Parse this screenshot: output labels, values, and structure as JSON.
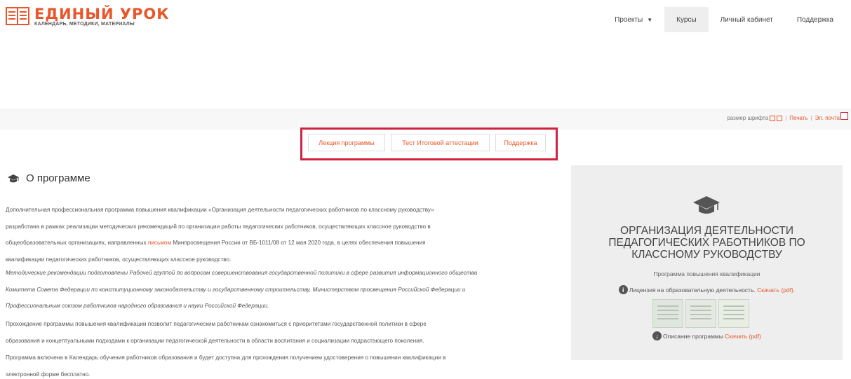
{
  "header": {
    "logo_title": "ЕДИНЫЙ УРОК",
    "logo_subtitle": "КАЛЕНДАРЬ, МЕТОДИКИ, МАТЕРИАЛЫ",
    "nav": [
      {
        "label": "Проекты",
        "has_dropdown": true,
        "active": false
      },
      {
        "label": "Курсы",
        "active": true
      },
      {
        "label": "Личный кабинет",
        "active": false
      },
      {
        "label": "Поддержка",
        "active": false
      }
    ]
  },
  "toolbar": {
    "font_size_label": "размер шрифта",
    "print_label": "Печать",
    "email_label": "Эл. почта"
  },
  "tabs": [
    {
      "label": "Лекция программы"
    },
    {
      "label": "Тест Итоговой аттестации"
    },
    {
      "label": "Поддержка"
    }
  ],
  "main": {
    "section_title": "О программе",
    "p1_line1": "Дополнительная профессиональная программа повышения квалификации «Организация деятельности педагогических работников по классному руководству»",
    "p1_line2": "разработана в рамках реализации методических рекомендаций по организации работы педагогических работников, осуществляющих классное руководство в",
    "p1_line3_pre": "общеобразовательных организациях, направленных ",
    "p1_link": "письмом",
    "p1_line3_post": " Минпросвещения России от ВБ-1011/08 от 12 мая 2020 года, в целях обеспечения повышения",
    "p1_line4": "квалификации педагогических работников, осуществляющих классное руководство.",
    "p2_line1": "Методические рекомендации подготовлены Рабочей группой по вопросам совершенствования государственной политики в сфере развития информационного общества",
    "p2_line2": "Комитета Совета Федерации по конституционному законодательству и государственному строительству, Министерством просвещения Российской Федерации и",
    "p2_line3": "Профессиональным союзом работников народного образования и науки Российской Федерации.",
    "p3_line1": "Прохождение программы повышения квалификации позволит педагогическим работникам ознакомиться с приоритетами государственной политики в сфере",
    "p3_line2": "образования и концептуальными подходами к организации педагогической деятельности в области воспитания и социализации подрастающего поколения.",
    "p4_line1": "Программа включена в Календарь обучения работников образования и будет доступна для прохождения получением удостоверения о повышении квалификации в",
    "p4_line2": "электронной форме бесплатно."
  },
  "sidebar": {
    "title_line1": "ОРГАНИЗАЦИЯ ДЕЯТЕЛЬНОСТИ",
    "title_line2": "ПЕДАГОГИЧЕСКИХ РАБОТНИКОВ ПО",
    "title_line3": "КЛАССНОМУ РУКОВОДСТВУ",
    "subtitle": "Программа повышения квалификации",
    "license_text": "Лицензия на образовательную деятельность.",
    "license_link": "Скачать (pdf).",
    "description_text": "Описание программы",
    "description_link": "Скачать (pdf)"
  },
  "colors": {
    "accent": "#e8562a",
    "highlight_box": "#d0213f",
    "sidebar_bg": "#eeeeee"
  }
}
